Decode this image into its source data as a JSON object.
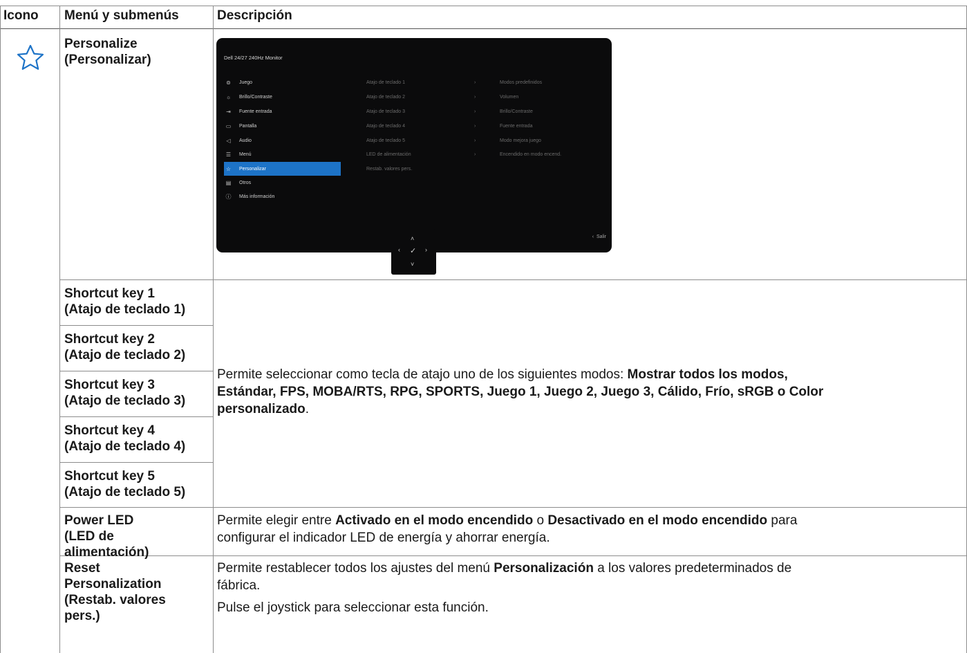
{
  "header": {
    "col_icon": "Icono",
    "col_menu": "Menú y submenús",
    "col_desc": "Descripción"
  },
  "icon": {
    "name": "star-icon",
    "color": "#1d73c7"
  },
  "rows": {
    "personalize": {
      "line1": "Personalize",
      "line2": "(Personalizar)"
    },
    "sk1": {
      "line1": "Shortcut key 1",
      "line2": "(Atajo de teclado 1)"
    },
    "sk2": {
      "line1": "Shortcut key 2",
      "line2": "(Atajo de teclado 2)"
    },
    "sk3": {
      "line1": "Shortcut key 3",
      "line2": "(Atajo de teclado 3)"
    },
    "sk4": {
      "line1": "Shortcut key 4",
      "line2": "(Atajo de teclado 4)"
    },
    "sk5": {
      "line1": "Shortcut key 5",
      "line2": "(Atajo de teclado 5)"
    },
    "power_led": {
      "line1": "Power LED",
      "line2": "(LED de",
      "line3": "alimentación)"
    },
    "reset": {
      "line1": "Reset",
      "line2": "Personalization",
      "line3": "(Restab. valores",
      "line4": "pers.)"
    }
  },
  "descriptions": {
    "shortcut": {
      "text1": "Permite seleccionar como tecla de atajo uno de los siguientes modos: ",
      "bold1": "Mostrar todos los modos,",
      "bold2": "Estándar, FPS, MOBA/RTS, RPG, SPORTS, Juego 1, Juego 2, Juego 3, Cálido, Frío, sRGB o Color",
      "bold3": "personalizado",
      "text2": "."
    },
    "power_led": {
      "text1": "Permite elegir entre ",
      "bold1": "Activado en el modo encendido",
      "text2": " o ",
      "bold2": "Desactivado en el modo encendido",
      "text3": " para",
      "line2": "configurar el indicador LED de energía y ahorrar energía."
    },
    "reset": {
      "text1": "Permite restablecer todos los ajustes del menú ",
      "bold1": "Personalización",
      "text2": " a los valores predeterminados de",
      "line2": "fábrica.",
      "line3": "Pulse el joystick para seleccionar esta función."
    }
  },
  "osd": {
    "title": "Dell 24/27 240Hz Monitor",
    "menu": [
      {
        "label": "Juego",
        "icon": "gamepad-icon"
      },
      {
        "label": "Brillo/Contraste",
        "icon": "brightness-icon"
      },
      {
        "label": "Fuente entrada",
        "icon": "input-source-icon"
      },
      {
        "label": "Pantalla",
        "icon": "display-icon"
      },
      {
        "label": "Audio",
        "icon": "speaker-icon"
      },
      {
        "label": "Menú",
        "icon": "menu-icon"
      },
      {
        "label": "Personalizar",
        "icon": "star-icon"
      },
      {
        "label": "Otros",
        "icon": "others-icon"
      },
      {
        "label": "Más información",
        "icon": "info-icon"
      }
    ],
    "selected": "Personalizar",
    "submenu": [
      "Atajo de teclado 1",
      "Atajo de teclado 2",
      "Atajo de teclado 3",
      "Atajo de teclado 4",
      "Atajo de teclado 5",
      "LED de alimentación",
      "Restab. valores pers."
    ],
    "values": [
      "Modos predefinidos",
      "Volumen",
      "Brillo/Contraste",
      "Fuente entrada",
      "Modo mejora juego",
      "Encendido en modo encend."
    ],
    "exit": "Salir",
    "selected_color": "#1d73c7"
  }
}
